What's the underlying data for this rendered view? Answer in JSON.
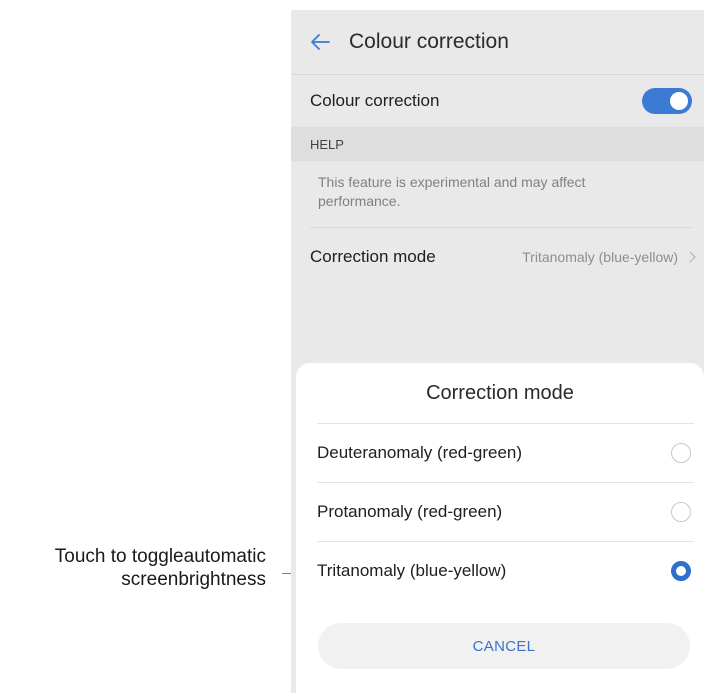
{
  "annotation": {
    "line1": "Touch to toggleautomatic",
    "line2": "screenbrightness"
  },
  "appbar": {
    "title": "Colour correction",
    "back_icon": "arrow-left-icon"
  },
  "settings": {
    "colour_correction_label": "Colour correction",
    "colour_correction_enabled": true,
    "help_header": "HELP",
    "help_text": "This feature is experimental and may affect performance.",
    "correction_mode_label": "Correction mode",
    "correction_mode_value": "Tritanomaly (blue-yellow)"
  },
  "dialog": {
    "title": "Correction mode",
    "options": [
      {
        "label": "Deuteranomaly (red-green)",
        "selected": false
      },
      {
        "label": "Protanomaly (red-green)",
        "selected": false
      },
      {
        "label": "Tritanomaly (blue-yellow)",
        "selected": true
      }
    ],
    "cancel_label": "CANCEL"
  },
  "colors": {
    "accent": "#3b7bd4",
    "annotation_line": "#2aa5a5"
  }
}
